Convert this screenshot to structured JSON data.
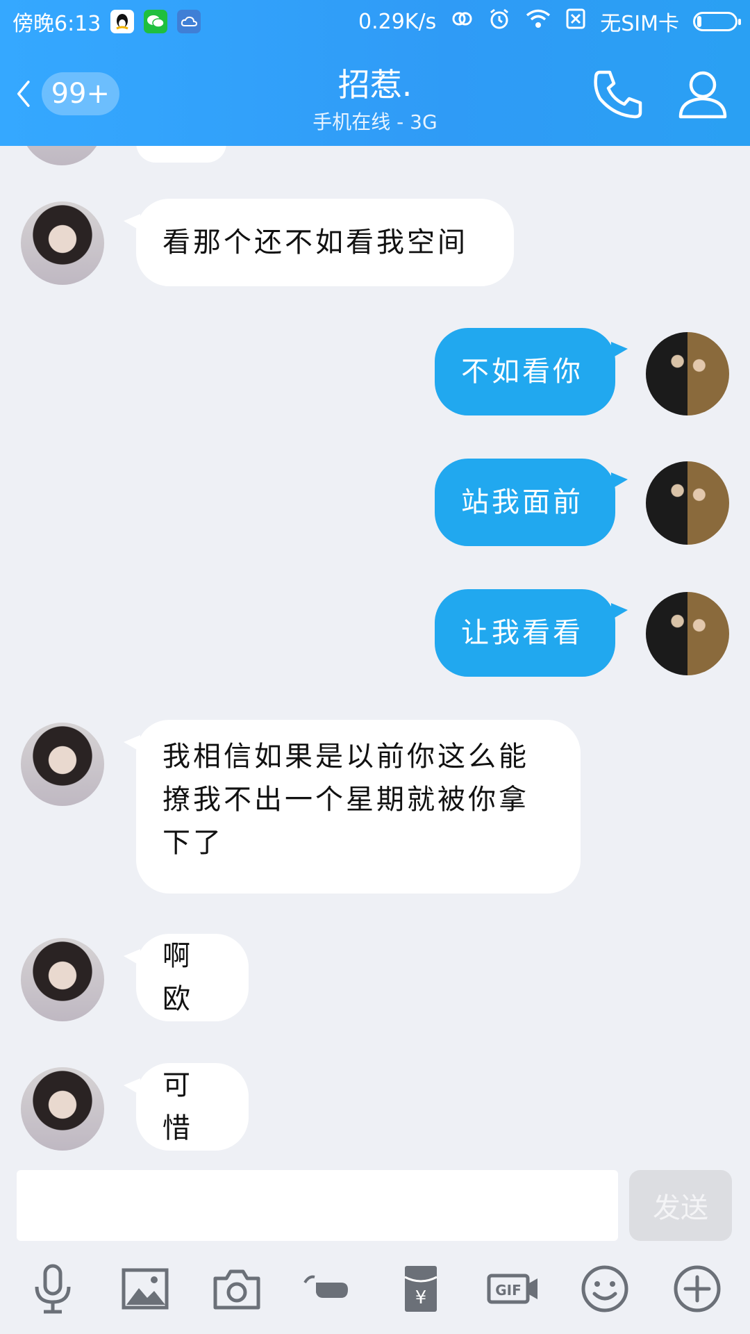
{
  "status_bar": {
    "time": "傍晚6:13",
    "speed": "0.29K/s",
    "sim": "无SIM卡"
  },
  "header": {
    "unread_badge": "99+",
    "title": "招惹.",
    "subtitle": "手机在线 - 3G"
  },
  "messages": [
    {
      "side": "left",
      "text": "看那个还不如看我空间"
    },
    {
      "side": "right",
      "text": "不如看你"
    },
    {
      "side": "right",
      "text": "站我面前"
    },
    {
      "side": "right",
      "text": "让我看看"
    },
    {
      "side": "left",
      "lines": [
        "我相信如果是以前你这么能",
        "撩我不出一个星期就被你拿",
        "下了"
      ]
    },
    {
      "side": "left",
      "text": "啊欧"
    },
    {
      "side": "left",
      "text": "可惜"
    }
  ],
  "input": {
    "value": "",
    "send_label": "发送"
  },
  "toolbar": {
    "gif_label": "GIF",
    "icons": [
      "microphone-icon",
      "image-icon",
      "camera-icon",
      "poke-icon",
      "red-packet-icon",
      "gif-icon",
      "emoji-icon",
      "plus-icon"
    ]
  },
  "colors": {
    "header_blue": "#2f9bf6",
    "my_bubble": "#21a8ef",
    "their_bubble": "#ffffff",
    "background": "#eef0f5"
  }
}
